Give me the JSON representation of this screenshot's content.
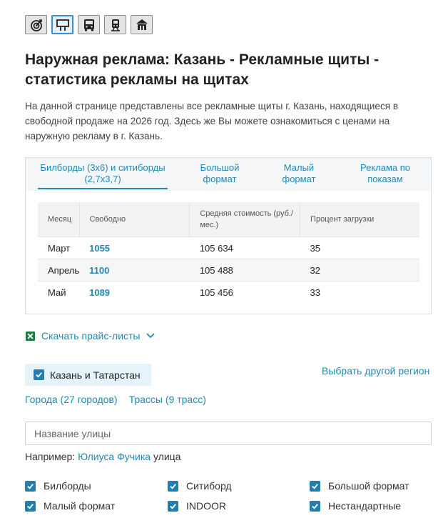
{
  "icon_bar": {
    "items": [
      {
        "icon": "target-icon",
        "active": false
      },
      {
        "icon": "billboard-icon",
        "active": true
      },
      {
        "icon": "bus-icon",
        "active": false
      },
      {
        "icon": "train-icon",
        "active": false
      },
      {
        "icon": "building-icon",
        "active": false
      }
    ]
  },
  "page": {
    "title": "Наружная реклама: Казань - Рекламные щиты - статистика рекламы на щитах",
    "intro": "На данной странице представлены все рекламные щиты г. Казань, находящиеся в свободной продаже на 2026 год. Здесь же Вы можете ознакомиться с ценами на наружную рекламу в г. Казань."
  },
  "tabs": [
    {
      "label": "Билборды (3x6) и ситиборды (2,7x3,7)",
      "active": true
    },
    {
      "label": "Большой формат",
      "active": false
    },
    {
      "label": "Малый формат",
      "active": false
    },
    {
      "label": "Реклама по показам",
      "active": false
    }
  ],
  "table": {
    "headers": [
      "Месяц",
      "Свободно",
      "Средняя стоимость (руб./мес.)",
      "Процент загрузки"
    ],
    "rows": [
      {
        "month": "Март",
        "free": "1055",
        "avg_price": "105 634",
        "load": "35"
      },
      {
        "month": "Апрель",
        "free": "1100",
        "avg_price": "105 488",
        "load": "32"
      },
      {
        "month": "Май",
        "free": "1089",
        "avg_price": "105 456",
        "load": "33"
      }
    ]
  },
  "download": {
    "label": "Скачать прайс-листы"
  },
  "region": {
    "selected": "Казань и Татарстан",
    "other_link": "Выбрать другой регион",
    "cities_link": "Города (27 городов)",
    "routes_link": "Трассы (9 трасс)"
  },
  "search": {
    "placeholder": "Название улицы",
    "value": ""
  },
  "example": {
    "prefix": "Например:",
    "link": "Юлиуса Фучика",
    "suffix": "улица"
  },
  "filters": [
    {
      "label": "Билборды",
      "checked": true
    },
    {
      "label": "Ситиборд",
      "checked": true
    },
    {
      "label": "Большой формат",
      "checked": true
    },
    {
      "label": "Малый формат",
      "checked": true
    },
    {
      "label": "INDOOR",
      "checked": true
    },
    {
      "label": "Нестандартные",
      "checked": true
    }
  ],
  "colors": {
    "accent": "#1f8bb5",
    "checkbox": "#1f7fb0",
    "excel": "#1e7b45"
  }
}
